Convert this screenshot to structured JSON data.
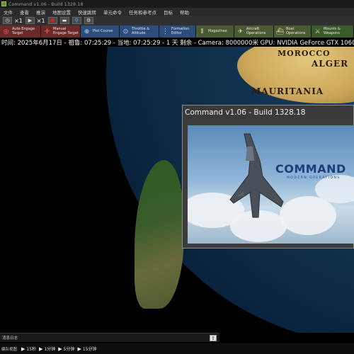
{
  "window": {
    "title": "Command v1.06 - Build 1328.18"
  },
  "menu": [
    "文件",
    "查看",
    "推演",
    "地图设置",
    "快速跳转",
    "单元命令",
    "任务和参考点",
    "目标",
    "帮助"
  ],
  "controls": {
    "speed_label": "×1",
    "speed_label_2": "×1"
  },
  "toolbar": [
    {
      "label": "Auto Engage\nTarget",
      "icon": "auto-engage-icon",
      "color": "red"
    },
    {
      "label": "Manual\nEngage Target",
      "icon": "manual-engage-icon",
      "color": "red"
    },
    {
      "label": "Plot Course",
      "icon": "plot-course-icon",
      "color": "blue"
    },
    {
      "label": "Throttle &\nAltitude",
      "icon": "throttle-icon",
      "color": "blue"
    },
    {
      "label": "Formation\nEditor",
      "icon": "formation-icon",
      "color": "blue"
    },
    {
      "label": "Magazines",
      "icon": "magazines-icon",
      "color": "green"
    },
    {
      "label": "Aircraft\nOperations",
      "icon": "aircraft-icon",
      "color": "green"
    },
    {
      "label": "Boat\nOperations",
      "icon": "boat-icon",
      "color": "green"
    },
    {
      "label": "Mounts &\nWeapons",
      "icon": "mounts-icon",
      "color": "darkgreen"
    }
  ],
  "status": {
    "text": "时间:  2025年6月17日 - 祖鲁:  07:25:29 - 当地:  07:25:29 - 1 天 剩余 -  Camera: 8000000米  GPU: NVIDIA GeForce GTX 1060"
  },
  "map": {
    "labels": [
      "MOROCCO",
      "ALGER",
      "MAURITANIA"
    ]
  },
  "splash": {
    "title": "Command v1.06 - Build 1328.18",
    "brand": "COMMAND",
    "brand_sub": "MODERN OPERATIONS"
  },
  "message_log": {
    "label": "消息日志"
  },
  "timebar": {
    "label": "编队视图",
    "steps": [
      "15秒",
      "1分钟",
      "5分钟",
      "15分钟"
    ]
  }
}
